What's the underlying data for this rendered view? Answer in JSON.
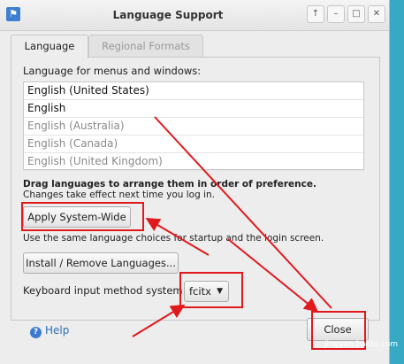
{
  "window": {
    "title": "Language Support",
    "controls": [
      "↑",
      "–",
      "□",
      "✕"
    ]
  },
  "tabs": [
    {
      "label": "Language"
    },
    {
      "label": "Regional Formats"
    }
  ],
  "language": {
    "menus_label": "Language for menus and windows:",
    "languages": [
      "English (United States)",
      "English",
      "English (Australia)",
      "English (Canada)",
      "English (United Kingdom)"
    ],
    "drag_hint": "Drag languages to arrange them in order of preference.",
    "change_note": "Changes take effect next time you log in.",
    "apply_button": "Apply System-Wide",
    "apply_note": "Use the same language choices for startup and the login screen.",
    "install_button": "Install / Remove Languages...",
    "keyboard_label": "Keyboard input method system:",
    "keyboard_value": "fcitx"
  },
  "footer": {
    "help_label": "Help",
    "close_label": "Close"
  },
  "watermark": "jingyan.baidu.com",
  "colors": {
    "annotation_red": "#e0191d",
    "desktop": "#37a9c4"
  }
}
